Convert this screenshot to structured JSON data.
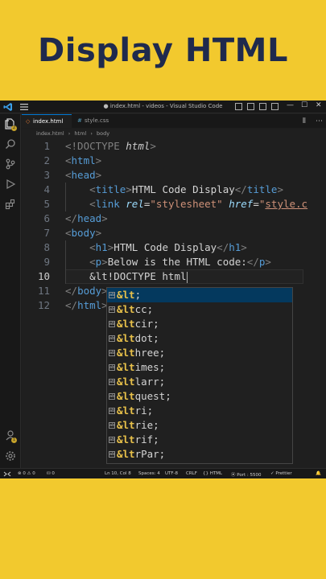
{
  "banner": {
    "title": "Display HTML"
  },
  "titlebar": {
    "title": "● index.html - videos - Visual Studio Code"
  },
  "activity_badges": {
    "explorer": "2",
    "accounts": "1"
  },
  "tabs": [
    {
      "label": "index.html",
      "modified": true,
      "active": true
    },
    {
      "label": "style.css",
      "active": false
    }
  ],
  "breadcrumb": {
    "file": "index.html",
    "node1": "html",
    "node2": "body"
  },
  "editor": {
    "line_numbers": [
      "1",
      "2",
      "3",
      "4",
      "5",
      "6",
      "7",
      "8",
      "9",
      "10",
      "11",
      "12"
    ],
    "current_line": "10",
    "lines": {
      "l1_a": "<!DOCTYPE ",
      "l1_b": "html",
      "l1_c": ">",
      "l2_a": "<",
      "l2_b": "html",
      "l2_c": ">",
      "l3_a": "<",
      "l3_b": "head",
      "l3_c": ">",
      "l4_a": "    <",
      "l4_b": "title",
      "l4_c": ">",
      "l4_d": "HTML Code Display",
      "l4_e": "</",
      "l4_f": "title",
      "l4_g": ">",
      "l5_a": "    <",
      "l5_b": "link",
      "l5_c": " ",
      "l5_d": "rel",
      "l5_e": "=",
      "l5_f": "\"stylesheet\"",
      "l5_g": " ",
      "l5_h": "href",
      "l5_i": "=",
      "l5_j": "\"",
      "l5_k": "style.c",
      "l6_a": "</",
      "l6_b": "head",
      "l6_c": ">",
      "l7_a": "<",
      "l7_b": "body",
      "l7_c": ">",
      "l8_a": "    <",
      "l8_b": "h1",
      "l8_c": ">",
      "l8_d": "HTML Code Display",
      "l8_e": "</",
      "l8_f": "h1",
      "l8_g": ">",
      "l9_a": "    <",
      "l9_b": "p",
      "l9_c": ">",
      "l9_d": "Below is the HTML code:",
      "l9_e": "</",
      "l9_f": "p",
      "l9_g": ">",
      "l10": "    &lt!DOCTYPE html",
      "l11_a": "</",
      "l11_b": "body",
      "l11_c": ">",
      "l12_a": "</",
      "l12_b": "html",
      "l12_c": ">"
    }
  },
  "suggestions": [
    {
      "match": "&lt",
      "rest": ";"
    },
    {
      "match": "&lt",
      "rest": "cc;"
    },
    {
      "match": "&lt",
      "rest": "cir;"
    },
    {
      "match": "&lt",
      "rest": "dot;"
    },
    {
      "match": "&lt",
      "rest": "hree;"
    },
    {
      "match": "&lt",
      "rest": "imes;"
    },
    {
      "match": "&lt",
      "rest": "larr;"
    },
    {
      "match": "&lt",
      "rest": "quest;"
    },
    {
      "match": "&lt",
      "rest": "ri;"
    },
    {
      "match": "&lt",
      "rest": "rie;"
    },
    {
      "match": "&lt",
      "rest": "rif;"
    },
    {
      "match": "&lt",
      "rest": "rPar;"
    }
  ],
  "statusbar": {
    "problems": "⊗ 0 ⚠ 0",
    "ports": "⛁ 0",
    "position": "Ln 10, Col 8",
    "spaces": "Spaces: 4",
    "encoding": "UTF-8",
    "eol": "CRLF",
    "language": "HTML",
    "port": "Port : 5500",
    "formatter": "✓ Prettier"
  },
  "colors": {
    "banner_bg": "#F2C92E",
    "banner_text": "#1F2A4D",
    "editor_bg": "#1F1F1F",
    "accent": "#0078D4",
    "suggest_match": "#E7C04A"
  }
}
